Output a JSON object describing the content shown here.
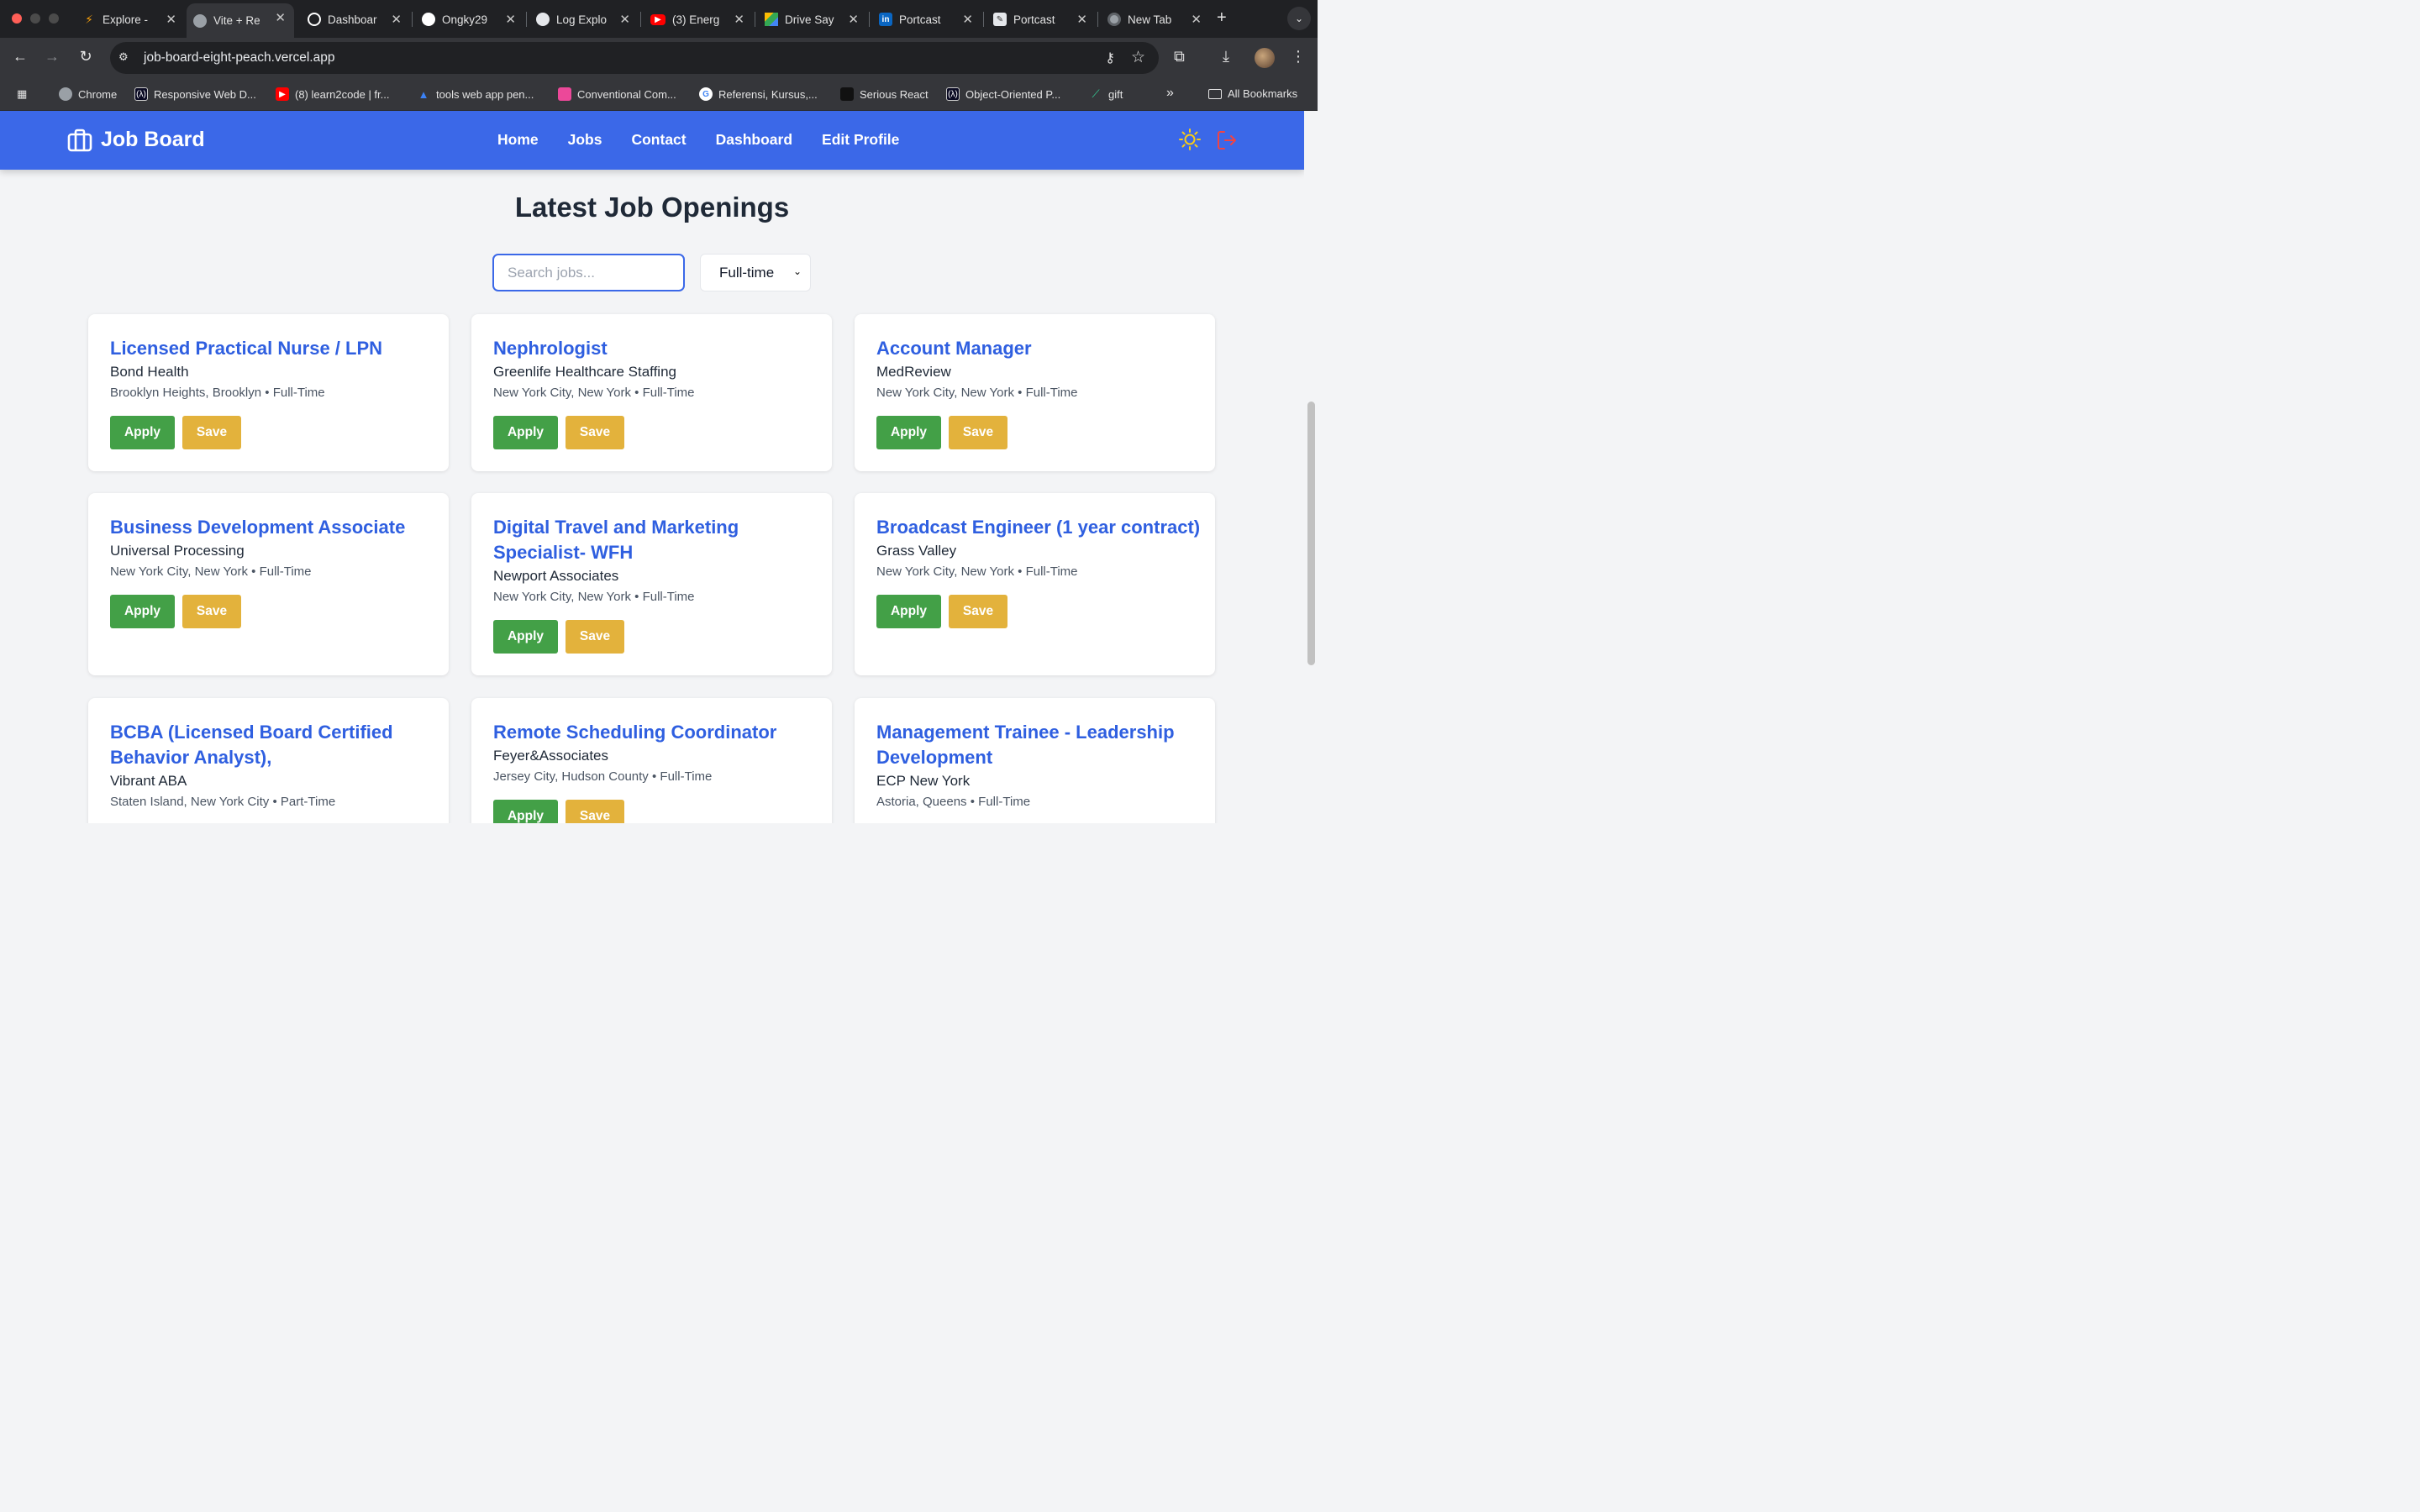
{
  "browser": {
    "tabs": [
      {
        "title": "Explore -",
        "icon": "explore-favicon",
        "color": "#f59e0b"
      },
      {
        "title": "Vite + Re",
        "icon": "globe-favicon",
        "color": "#9aa0a6"
      },
      {
        "title": "Dashboar",
        "icon": "openai-favicon",
        "color": "#ffffff"
      },
      {
        "title": "Ongky29",
        "icon": "github-favicon",
        "color": "#ffffff"
      },
      {
        "title": "Log Explo",
        "icon": "log-explorer-favicon",
        "color": "#e5e7eb"
      },
      {
        "title": "(3) Energ",
        "icon": "youtube-favicon",
        "color": "#ff0000"
      },
      {
        "title": "Drive Say",
        "icon": "google-drive-favicon",
        "color": "#34a853"
      },
      {
        "title": "Portcast",
        "icon": "linkedin-favicon",
        "color": "#0a66c2"
      },
      {
        "title": "Portcast",
        "icon": "pen-favicon",
        "color": "#e5e7eb"
      },
      {
        "title": "New Tab",
        "icon": "chrome-favicon",
        "color": "#9aa0a6"
      }
    ],
    "active_tab_index": 1,
    "url": "job-board-eight-peach.vercel.app",
    "bookmarks": [
      {
        "label": "Chrome",
        "icon": "chrome-icon",
        "color": "#9aa0a6"
      },
      {
        "label": "Responsive Web D...",
        "icon": "freecodecamp-icon",
        "color": "#0a0a23"
      },
      {
        "label": "(8) learn2code | fr...",
        "icon": "youtube-icon",
        "color": "#ff0000"
      },
      {
        "label": "tools web app pen...",
        "icon": "triangle-icon",
        "color": "#3b82f6"
      },
      {
        "label": "Conventional Com...",
        "icon": "conventional-commits-icon",
        "color": "#ec4899"
      },
      {
        "label": "Referensi, Kursus,...",
        "icon": "google-icon",
        "color": "#ffffff"
      },
      {
        "label": "Serious React",
        "icon": "serious-react-icon",
        "color": "#111111"
      },
      {
        "label": "Object-Oriented P...",
        "icon": "freecodecamp-icon",
        "color": "#0a0a23"
      },
      {
        "label": "gift",
        "icon": "leaf-icon",
        "color": "#34d399"
      }
    ],
    "overflow_label": "»",
    "all_bookmarks_label": "All Bookmarks"
  },
  "navbar": {
    "brand": "Job Board",
    "links": [
      "Home",
      "Jobs",
      "Contact",
      "Dashboard",
      "Edit Profile"
    ],
    "brand_color": "#3b68e8",
    "theme_icon_color": "#facc15",
    "logout_icon_color": "#ef4444"
  },
  "main": {
    "heading": "Latest Job Openings",
    "search_placeholder": "Search jobs...",
    "search_value": "",
    "filter_selected": "Full-time"
  },
  "jobs": [
    {
      "title": "Licensed Practical Nurse / LPN",
      "company": "Bond Health",
      "location": "Brooklyn Heights, Brooklyn",
      "type": "Full-Time"
    },
    {
      "title": "Nephrologist",
      "company": "Greenlife Healthcare Staffing",
      "location": "New York City, New York",
      "type": "Full-Time"
    },
    {
      "title": "Account Manager",
      "company": "MedReview",
      "location": "New York City, New York",
      "type": "Full-Time"
    },
    {
      "title": "Business Development Associate",
      "company": "Universal Processing",
      "location": "New York City, New York",
      "type": "Full-Time"
    },
    {
      "title": "Digital Travel and Marketing Specialist- WFH",
      "company": "Newport Associates",
      "location": "New York City, New York",
      "type": "Full-Time"
    },
    {
      "title": "Broadcast Engineer (1 year contract)",
      "company": "Grass Valley",
      "location": "New York City, New York",
      "type": "Full-Time"
    },
    {
      "title": "BCBA (Licensed Board Certified Behavior Analyst),",
      "company": "Vibrant ABA",
      "location": "Staten Island, New York City",
      "type": "Part-Time"
    },
    {
      "title": "Remote Scheduling Coordinator",
      "company": "Feyer&Associates",
      "location": "Jersey City, Hudson County",
      "type": "Full-Time"
    },
    {
      "title": "Management Trainee - Leadership Development",
      "company": "ECP New York",
      "location": "Astoria, Queens",
      "type": "Full-Time"
    }
  ],
  "buttons": {
    "apply": "Apply",
    "save": "Save"
  },
  "meta_separator": "•",
  "colors": {
    "apply": "#43a047",
    "save": "#e3b23c",
    "job_title": "#2f5fe0"
  }
}
